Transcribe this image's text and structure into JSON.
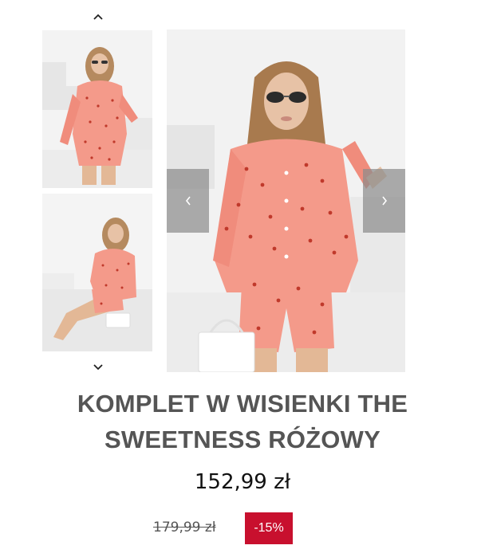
{
  "gallery": {
    "thumbnails": [
      {
        "alt": "model-standing-in-pink-cherry-print-set"
      },
      {
        "alt": "model-sitting-in-pink-cherry-print-set"
      }
    ],
    "icons": {
      "thumb_up": "chevron-up-icon",
      "thumb_down": "chevron-down-icon",
      "prev": "chevron-left-icon",
      "next": "chevron-right-icon"
    }
  },
  "product": {
    "title_line1": "KOMPLET W WISIENKI THE",
    "title_line2": "SWEETNESS RÓŻOWY",
    "price": "152,99 zł",
    "old_price": "179,99 zł",
    "discount": "-15%"
  },
  "colors": {
    "discount_badge": "#c8102e",
    "outfit": "#f49a8a",
    "arrow_overlay": "#8c8c8c"
  }
}
